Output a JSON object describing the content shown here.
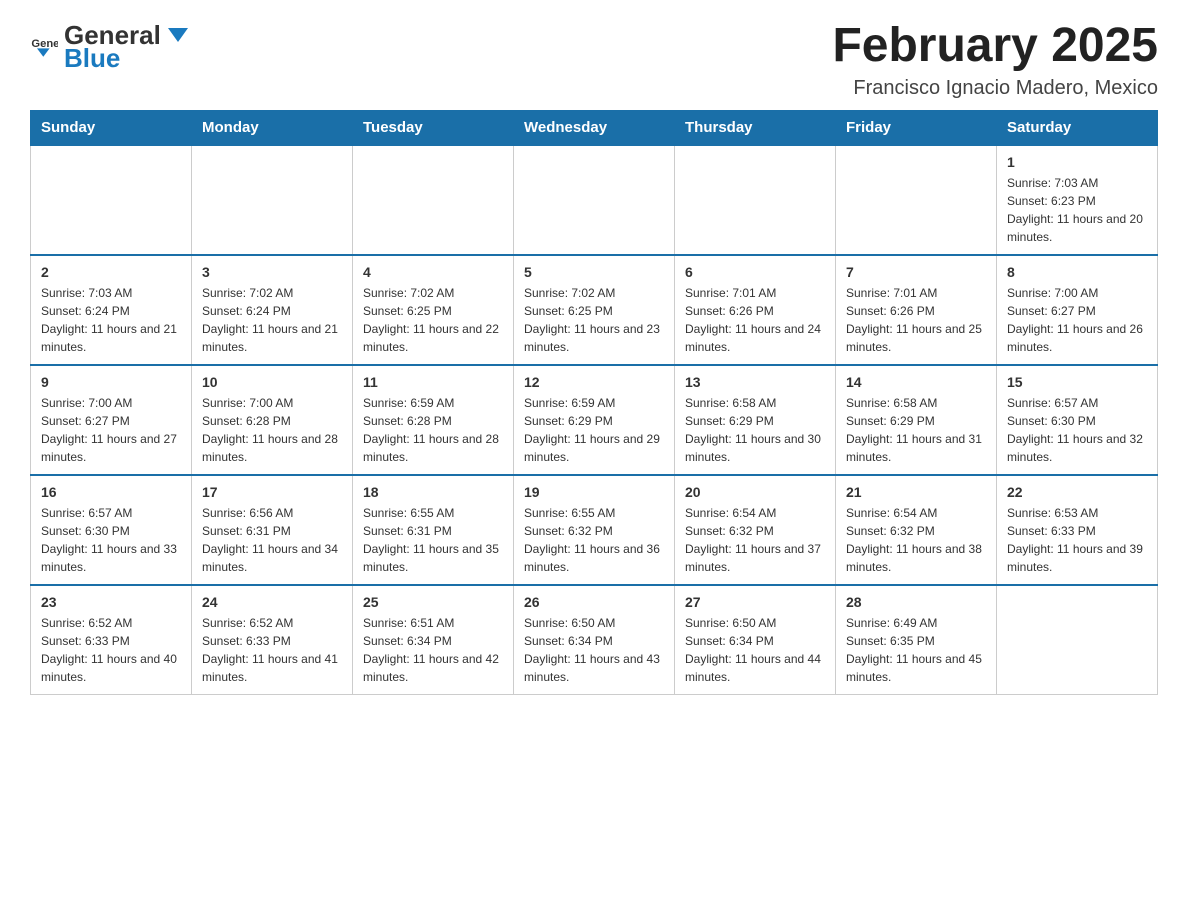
{
  "header": {
    "logo": {
      "general": "General",
      "blue": "Blue"
    },
    "title": "February 2025",
    "location": "Francisco Ignacio Madero, Mexico"
  },
  "weekdays": [
    "Sunday",
    "Monday",
    "Tuesday",
    "Wednesday",
    "Thursday",
    "Friday",
    "Saturday"
  ],
  "weeks": [
    {
      "days": [
        {
          "num": "",
          "info": ""
        },
        {
          "num": "",
          "info": ""
        },
        {
          "num": "",
          "info": ""
        },
        {
          "num": "",
          "info": ""
        },
        {
          "num": "",
          "info": ""
        },
        {
          "num": "",
          "info": ""
        },
        {
          "num": "1",
          "info": "Sunrise: 7:03 AM\nSunset: 6:23 PM\nDaylight: 11 hours and 20 minutes."
        }
      ]
    },
    {
      "days": [
        {
          "num": "2",
          "info": "Sunrise: 7:03 AM\nSunset: 6:24 PM\nDaylight: 11 hours and 21 minutes."
        },
        {
          "num": "3",
          "info": "Sunrise: 7:02 AM\nSunset: 6:24 PM\nDaylight: 11 hours and 21 minutes."
        },
        {
          "num": "4",
          "info": "Sunrise: 7:02 AM\nSunset: 6:25 PM\nDaylight: 11 hours and 22 minutes."
        },
        {
          "num": "5",
          "info": "Sunrise: 7:02 AM\nSunset: 6:25 PM\nDaylight: 11 hours and 23 minutes."
        },
        {
          "num": "6",
          "info": "Sunrise: 7:01 AM\nSunset: 6:26 PM\nDaylight: 11 hours and 24 minutes."
        },
        {
          "num": "7",
          "info": "Sunrise: 7:01 AM\nSunset: 6:26 PM\nDaylight: 11 hours and 25 minutes."
        },
        {
          "num": "8",
          "info": "Sunrise: 7:00 AM\nSunset: 6:27 PM\nDaylight: 11 hours and 26 minutes."
        }
      ]
    },
    {
      "days": [
        {
          "num": "9",
          "info": "Sunrise: 7:00 AM\nSunset: 6:27 PM\nDaylight: 11 hours and 27 minutes."
        },
        {
          "num": "10",
          "info": "Sunrise: 7:00 AM\nSunset: 6:28 PM\nDaylight: 11 hours and 28 minutes."
        },
        {
          "num": "11",
          "info": "Sunrise: 6:59 AM\nSunset: 6:28 PM\nDaylight: 11 hours and 28 minutes."
        },
        {
          "num": "12",
          "info": "Sunrise: 6:59 AM\nSunset: 6:29 PM\nDaylight: 11 hours and 29 minutes."
        },
        {
          "num": "13",
          "info": "Sunrise: 6:58 AM\nSunset: 6:29 PM\nDaylight: 11 hours and 30 minutes."
        },
        {
          "num": "14",
          "info": "Sunrise: 6:58 AM\nSunset: 6:29 PM\nDaylight: 11 hours and 31 minutes."
        },
        {
          "num": "15",
          "info": "Sunrise: 6:57 AM\nSunset: 6:30 PM\nDaylight: 11 hours and 32 minutes."
        }
      ]
    },
    {
      "days": [
        {
          "num": "16",
          "info": "Sunrise: 6:57 AM\nSunset: 6:30 PM\nDaylight: 11 hours and 33 minutes."
        },
        {
          "num": "17",
          "info": "Sunrise: 6:56 AM\nSunset: 6:31 PM\nDaylight: 11 hours and 34 minutes."
        },
        {
          "num": "18",
          "info": "Sunrise: 6:55 AM\nSunset: 6:31 PM\nDaylight: 11 hours and 35 minutes."
        },
        {
          "num": "19",
          "info": "Sunrise: 6:55 AM\nSunset: 6:32 PM\nDaylight: 11 hours and 36 minutes."
        },
        {
          "num": "20",
          "info": "Sunrise: 6:54 AM\nSunset: 6:32 PM\nDaylight: 11 hours and 37 minutes."
        },
        {
          "num": "21",
          "info": "Sunrise: 6:54 AM\nSunset: 6:32 PM\nDaylight: 11 hours and 38 minutes."
        },
        {
          "num": "22",
          "info": "Sunrise: 6:53 AM\nSunset: 6:33 PM\nDaylight: 11 hours and 39 minutes."
        }
      ]
    },
    {
      "days": [
        {
          "num": "23",
          "info": "Sunrise: 6:52 AM\nSunset: 6:33 PM\nDaylight: 11 hours and 40 minutes."
        },
        {
          "num": "24",
          "info": "Sunrise: 6:52 AM\nSunset: 6:33 PM\nDaylight: 11 hours and 41 minutes."
        },
        {
          "num": "25",
          "info": "Sunrise: 6:51 AM\nSunset: 6:34 PM\nDaylight: 11 hours and 42 minutes."
        },
        {
          "num": "26",
          "info": "Sunrise: 6:50 AM\nSunset: 6:34 PM\nDaylight: 11 hours and 43 minutes."
        },
        {
          "num": "27",
          "info": "Sunrise: 6:50 AM\nSunset: 6:34 PM\nDaylight: 11 hours and 44 minutes."
        },
        {
          "num": "28",
          "info": "Sunrise: 6:49 AM\nSunset: 6:35 PM\nDaylight: 11 hours and 45 minutes."
        },
        {
          "num": "",
          "info": ""
        }
      ]
    }
  ]
}
